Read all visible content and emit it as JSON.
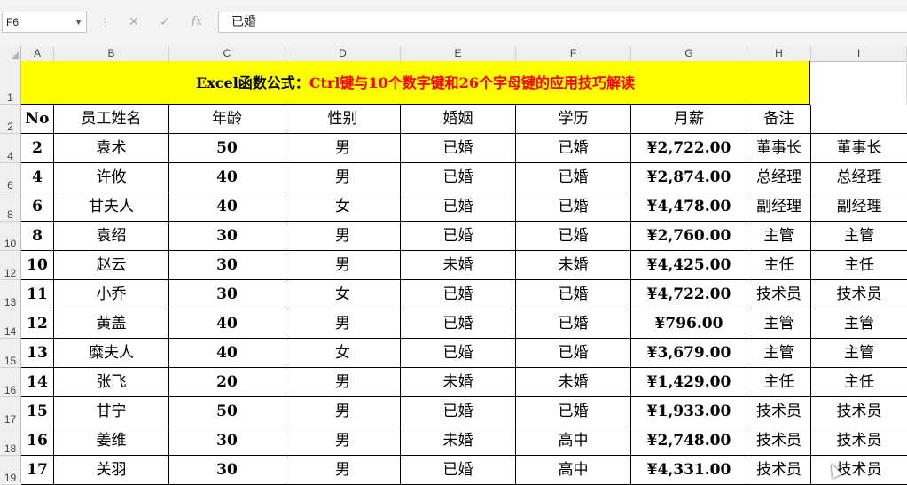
{
  "formula_bar": {
    "name_box": "F6",
    "more_symbol": "⋮",
    "cancel_icon": "✕",
    "enter_icon": "✓",
    "fx_label": "fx",
    "content": "已婚"
  },
  "columns": [
    "A",
    "B",
    "C",
    "D",
    "E",
    "F",
    "G",
    "H",
    "I"
  ],
  "rows": [
    "1",
    "2",
    "4",
    "6",
    "8",
    "10",
    "12",
    "13",
    "14",
    "15",
    "16",
    "17",
    "18",
    "19"
  ],
  "title": {
    "part1": "Excel函数公式：",
    "part2": "Ctrl键与10个数字键和26个字母键的应用技巧解读"
  },
  "title_colors": {
    "part1": "#000000",
    "part2": "#ff0000",
    "background": "#ffff00"
  },
  "table": {
    "headers": [
      "No",
      "员工姓名",
      "年龄",
      "性别",
      "婚姻",
      "学历",
      "月薪",
      "备注",
      ""
    ],
    "rows": [
      [
        "2",
        "袁术",
        "50",
        "男",
        "已婚",
        "已婚",
        "¥2,722.00",
        "董事长",
        "董事长"
      ],
      [
        "4",
        "许攸",
        "40",
        "男",
        "已婚",
        "已婚",
        "¥2,874.00",
        "总经理",
        "总经理"
      ],
      [
        "6",
        "甘夫人",
        "40",
        "女",
        "已婚",
        "已婚",
        "¥4,478.00",
        "副经理",
        "副经理"
      ],
      [
        "8",
        "袁绍",
        "30",
        "男",
        "已婚",
        "已婚",
        "¥2,760.00",
        "主管",
        "主管"
      ],
      [
        "10",
        "赵云",
        "30",
        "男",
        "未婚",
        "未婚",
        "¥4,425.00",
        "主任",
        "主任"
      ],
      [
        "11",
        "小乔",
        "30",
        "女",
        "已婚",
        "已婚",
        "¥4,722.00",
        "技术员",
        "技术员"
      ],
      [
        "12",
        "黄盖",
        "40",
        "男",
        "已婚",
        "已婚",
        "¥796.00",
        "主管",
        "主管"
      ],
      [
        "13",
        "糜夫人",
        "40",
        "女",
        "已婚",
        "已婚",
        "¥3,679.00",
        "主管",
        "主管"
      ],
      [
        "14",
        "张飞",
        "20",
        "男",
        "未婚",
        "未婚",
        "¥1,429.00",
        "主任",
        "主任"
      ],
      [
        "15",
        "甘宁",
        "50",
        "男",
        "已婚",
        "已婚",
        "¥1,933.00",
        "技术员",
        "技术员"
      ],
      [
        "16",
        "姜维",
        "30",
        "男",
        "未婚",
        "高中",
        "¥2,748.00",
        "技术员",
        "技术员"
      ],
      [
        "17",
        "关羽",
        "30",
        "男",
        "已婚",
        "高中",
        "¥4,331.00",
        "技术员",
        "技术员"
      ]
    ]
  }
}
